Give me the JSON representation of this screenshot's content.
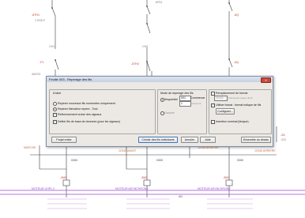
{
  "schematic": {
    "labels": {
      "top_left_ref": "-6TH1",
      "top_right_ref": "-6Q",
      "top_mid_small": "-6F51",
      "top_left_sub": "1 ROUT",
      "mid_left_ref": "-F1",
      "mid_mid_ref": "-6TH2",
      "mid_right_ref": "-6Q",
      "left_marker": "4AGS1",
      "sub_cable_1": "CH1",
      "sub_cable_2": "CH2",
      "right_ref": "-2A",
      "right_sub": "-SCI",
      "bus_left": "MARCHE",
      "bus_mid": "12345 AVANT",
      "bus_mid_2": "12345 ARRIERE",
      "bus_right": "12345 ARRIERE",
      "wire_1": "0300",
      "wire_2": "0300",
      "wire_3": "0300",
      "motor_1_ref": "-3M1",
      "motor_1_label": "MOTEUR CHPL.2",
      "motor_2_ref": "-3M2",
      "motor_2_label": "MOTEUR ASYNCHRONE",
      "motor_3_ref": "-3M3",
      "motor_3_label": "MOTEUR ASYNCHRONE",
      "bottom_mark": "4/1"
    }
  },
  "dialog": {
    "title": "Feuille 003 - Reperage des fils",
    "close_label": "X",
    "group_range": {
      "heading": "A faire",
      "option_1": "Reperer nouveaux fils numerotes uniquement",
      "option_2": "Reperer fils/valeur repere - Tout",
      "option_3": "Referencement croise des signaux",
      "option_4": "Definir fils de base de donnees (pour les signaux)",
      "selected": 2
    },
    "group_mode": {
      "heading": "Mode de reperage des fils",
      "sequential_label": "Sequentiel",
      "sequential_selected": true,
      "start_value": "001",
      "start_label": "Commence",
      "increment_value": "1",
      "increment_label": "Increment",
      "format_label": "Format",
      "format_value": "",
      "option_gauche": "Gauche"
    },
    "group_replace": {
      "replace_label": "Remplacement de format",
      "replace_value": "%%%",
      "replace_hint": "Format de repere de fil",
      "use_format_label": "Utiliser fornat : format indique de fils",
      "use_format_checked": true,
      "configure_label": "Configurer...",
      "insert_label": "Insertion nominal (bloque)"
    },
    "buttons": {
      "project": "Projet entier",
      "pick_wires": "Choisir des fils individuels",
      "cancel": "Annuler",
      "help": "Aide",
      "drawing": "Ensemble du dessin"
    }
  }
}
